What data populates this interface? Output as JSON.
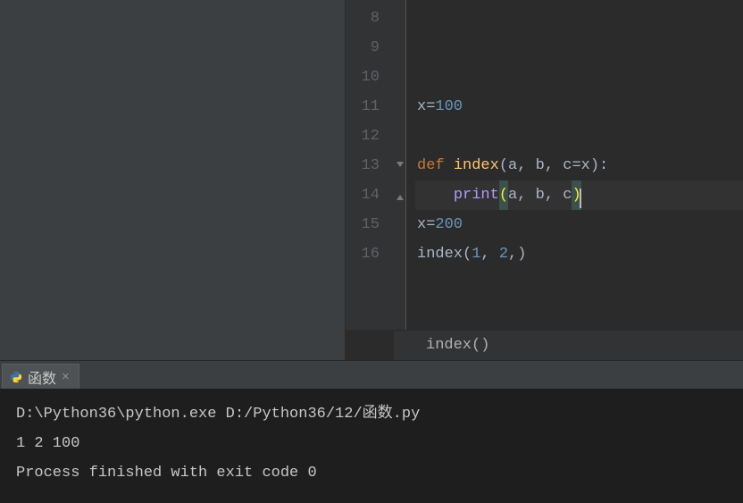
{
  "lines": [
    {
      "n": 8,
      "tokens": []
    },
    {
      "n": 9,
      "tokens": []
    },
    {
      "n": 10,
      "tokens": []
    },
    {
      "n": 11,
      "tokens": [
        {
          "t": "x",
          "c": "id"
        },
        {
          "t": "=",
          "c": "op"
        },
        {
          "t": "100",
          "c": "num"
        }
      ]
    },
    {
      "n": 12,
      "tokens": []
    },
    {
      "n": 13,
      "fold": "open",
      "tokens": [
        {
          "t": "def ",
          "c": "kw"
        },
        {
          "t": "index",
          "c": "fn"
        },
        {
          "t": "(",
          "c": "op"
        },
        {
          "t": "a",
          "c": "id"
        },
        {
          "t": ", ",
          "c": "op"
        },
        {
          "t": "b",
          "c": "id"
        },
        {
          "t": ", ",
          "c": "op"
        },
        {
          "t": "c",
          "c": "id"
        },
        {
          "t": "=",
          "c": "op"
        },
        {
          "t": "x",
          "c": "id"
        },
        {
          "t": "):",
          "c": "op"
        }
      ]
    },
    {
      "n": 14,
      "fold": "close",
      "current": true,
      "caret": true,
      "tokens": [
        {
          "t": "    ",
          "c": "op"
        },
        {
          "t": "print",
          "c": "call"
        },
        {
          "t": "(",
          "c": "brmatch"
        },
        {
          "t": "a",
          "c": "id"
        },
        {
          "t": ", ",
          "c": "op"
        },
        {
          "t": "b",
          "c": "id"
        },
        {
          "t": ", ",
          "c": "op"
        },
        {
          "t": "c",
          "c": "id"
        },
        {
          "t": ")",
          "c": "brmatch"
        }
      ]
    },
    {
      "n": 15,
      "tokens": [
        {
          "t": "x",
          "c": "id"
        },
        {
          "t": "=",
          "c": "op"
        },
        {
          "t": "200",
          "c": "num"
        }
      ]
    },
    {
      "n": 16,
      "tokens": [
        {
          "t": "index(",
          "c": "id"
        },
        {
          "t": "1",
          "c": "num"
        },
        {
          "t": ", ",
          "c": "op"
        },
        {
          "t": "2",
          "c": "num"
        },
        {
          "t": ",)",
          "c": "id"
        }
      ]
    }
  ],
  "breadcrumb": "index()",
  "tab_name": "函数",
  "console": [
    "D:\\Python36\\python.exe D:/Python36/12/函数.py",
    "1 2 100",
    "",
    "Process finished with exit code 0"
  ]
}
